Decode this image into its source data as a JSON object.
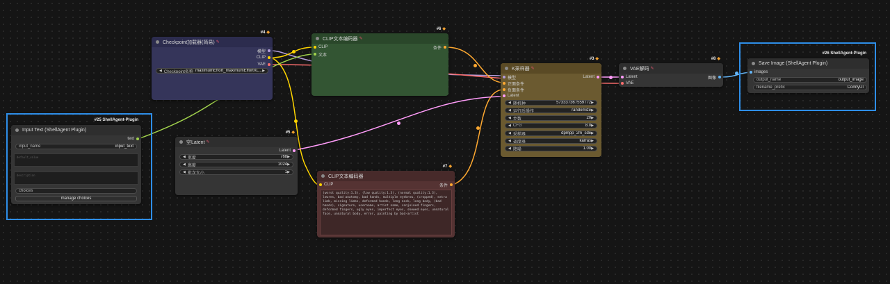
{
  "colors": {
    "model": "#b39ddb",
    "clip": "#ffd500",
    "vae": "#ff6e6e",
    "conditioning": "#ffa931",
    "latent": "#ff9cf9",
    "image": "#64b5f6",
    "string": "#a1d24c",
    "highlight": "#2e8ee8"
  },
  "checkpoint": {
    "badge": "#4",
    "title": "Checkpoint加载器(简易)",
    "outputs": [
      "模型",
      "CLIP",
      "VAE"
    ],
    "widget_label": "Checkpoint名称",
    "widget_value": "maximumEffort_maximumEffortXL..."
  },
  "clip_pos": {
    "badge": "#6",
    "title": "CLIP文本编码器",
    "inputs": [
      "CLIP",
      "文本"
    ],
    "output": "条件"
  },
  "ksampler": {
    "badge": "#3",
    "title": "K采样器",
    "inputs": [
      "模型",
      "正面条件",
      "负面条件",
      "Latent"
    ],
    "output": "Latent",
    "widgets": [
      {
        "label": "随机种",
        "value": "573337367559772"
      },
      {
        "label": "运行后操作",
        "value": "randomize"
      },
      {
        "label": "步数",
        "value": "20"
      },
      {
        "label": "CFG",
        "value": "8.0"
      },
      {
        "label": "采样器",
        "value": "dpmpp_2m_sde"
      },
      {
        "label": "调度器",
        "value": "karras"
      },
      {
        "label": "降噪",
        "value": "1.00"
      }
    ]
  },
  "vae_decode": {
    "badge": "#8",
    "title": "VAE解码",
    "inputs": [
      "Latent",
      "VAE"
    ],
    "output": "图像"
  },
  "save_image": {
    "badge": "#26 ShellAgent-Plugin",
    "title": "Save Image (ShellAgent Plugin)",
    "input": "images",
    "widgets": [
      {
        "label": "output_name",
        "value": "output_image"
      },
      {
        "label": "filename_prefix",
        "value": "ComfyUI"
      }
    ]
  },
  "input_text": {
    "badge": "#25 ShellAgent-Plugin",
    "title": "Input Text (ShellAgent Plugin)",
    "output": "text",
    "name_label": "input_name",
    "name_value": "input_text",
    "default_placeholder": "default_value",
    "desc_placeholder": "description",
    "choices_label": "choices",
    "manage_label": "manage choices"
  },
  "empty_latent": {
    "badge": "#5",
    "title": "空Latent",
    "output": "Latent",
    "widgets": [
      {
        "label": "宽度",
        "value": "768"
      },
      {
        "label": "高度",
        "value": "1024"
      },
      {
        "label": "批次大小",
        "value": "1"
      }
    ]
  },
  "clip_neg": {
    "badge": "#7",
    "title": "CLIP文本编码器",
    "input": "CLIP",
    "output": "条件",
    "text": "(worst quality:1.3), (low quality:1.3), (normal quality:1.3), lowres, bad anatomy, bad hands, multiple eyebrow, (cropped), extra limb, missing limbs, deformed hands, long neck, long body, (bad hands), signature, username, artist name, conjoined fingers, deformed fingers, ugly eyes, imperfect eyes, skewed eyes, unnatural face, unnatural body, error, painting by bad-artist"
  }
}
